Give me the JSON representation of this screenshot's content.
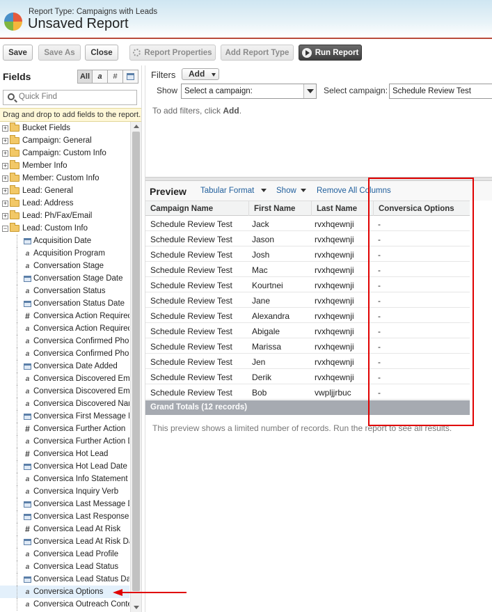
{
  "header": {
    "report_type": "Report Type: Campaigns with Leads",
    "title": "Unsaved Report"
  },
  "toolbar": {
    "save": "Save",
    "save_as": "Save As",
    "close": "Close",
    "report_properties": "Report Properties",
    "add_report_type": "Add Report Type",
    "run_report": "Run Report"
  },
  "fields_panel": {
    "title": "Fields",
    "filter_all": "All",
    "filter_text": "a",
    "filter_number": "#",
    "quick_find_placeholder": "Quick Find",
    "hint": "Drag and drop to add fields to the report.",
    "folders": [
      "Bucket Fields",
      "Campaign: General",
      "Campaign: Custom Info",
      "Member Info",
      "Member: Custom Info",
      "Lead: General",
      "Lead: Address",
      "Lead: Ph/Fax/Email",
      "Lead: Custom Info"
    ],
    "fields": [
      {
        "label": "Acquisition Date",
        "type": "date"
      },
      {
        "label": "Acquisition Program",
        "type": "text"
      },
      {
        "label": "Conversation Stage",
        "type": "text"
      },
      {
        "label": "Conversation Stage Date",
        "type": "date"
      },
      {
        "label": "Conversation Status",
        "type": "text"
      },
      {
        "label": "Conversation Status Date",
        "type": "date"
      },
      {
        "label": "Conversica Action Required",
        "type": "number"
      },
      {
        "label": "Conversica Action Required",
        "type": "text"
      },
      {
        "label": "Conversica Confirmed Phon",
        "type": "text"
      },
      {
        "label": "Conversica Confirmed Phon",
        "type": "text"
      },
      {
        "label": "Conversica Date Added",
        "type": "date"
      },
      {
        "label": "Conversica Discovered Ema",
        "type": "text"
      },
      {
        "label": "Conversica Discovered Ema",
        "type": "text"
      },
      {
        "label": "Conversica Discovered Nam",
        "type": "text"
      },
      {
        "label": "Conversica First Message D",
        "type": "date"
      },
      {
        "label": "Conversica Further Action",
        "type": "number"
      },
      {
        "label": "Conversica Further Action D",
        "type": "text"
      },
      {
        "label": "Conversica Hot Lead",
        "type": "number"
      },
      {
        "label": "Conversica Hot Lead Date",
        "type": "date"
      },
      {
        "label": "Conversica Info Statement",
        "type": "text"
      },
      {
        "label": "Conversica Inquiry Verb",
        "type": "text"
      },
      {
        "label": "Conversica Last Message D",
        "type": "date"
      },
      {
        "label": "Conversica Last Response D",
        "type": "date"
      },
      {
        "label": "Conversica Lead At Risk",
        "type": "number"
      },
      {
        "label": "Conversica Lead At Risk Da",
        "type": "date"
      },
      {
        "label": "Conversica Lead Profile",
        "type": "text"
      },
      {
        "label": "Conversica Lead Status",
        "type": "text"
      },
      {
        "label": "Conversica Lead Status Dat",
        "type": "date"
      },
      {
        "label": "Conversica Options",
        "type": "text"
      },
      {
        "label": "Conversica Outreach Contex",
        "type": "text"
      }
    ]
  },
  "filters": {
    "label": "Filters",
    "add": "Add",
    "show_label": "Show",
    "show_value": "Select a campaign:",
    "select_campaign_label": "Select campaign:",
    "campaign_value": "Schedule Review Test",
    "hint_prefix": "To add filters, click ",
    "hint_bold": "Add",
    "hint_suffix": "."
  },
  "preview": {
    "title": "Preview",
    "tabular_format": "Tabular Format",
    "show": "Show",
    "remove_all_columns": "Remove All Columns",
    "columns": [
      "Campaign Name",
      "First Name",
      "Last Name",
      "Conversica Options"
    ],
    "rows": [
      [
        "Schedule Review Test",
        "Jack",
        "rvxhqewnji",
        "-"
      ],
      [
        "Schedule Review Test",
        "Jason",
        "rvxhqewnji",
        "-"
      ],
      [
        "Schedule Review Test",
        "Josh",
        "rvxhqewnji",
        "-"
      ],
      [
        "Schedule Review Test",
        "Mac",
        "rvxhqewnji",
        "-"
      ],
      [
        "Schedule Review Test",
        "Kourtnei",
        "rvxhqewnji",
        "-"
      ],
      [
        "Schedule Review Test",
        "Jane",
        "rvxhqewnji",
        "-"
      ],
      [
        "Schedule Review Test",
        "Alexandra",
        "rvxhqewnji",
        "-"
      ],
      [
        "Schedule Review Test",
        "Abigale",
        "rvxhqewnji",
        "-"
      ],
      [
        "Schedule Review Test",
        "Marissa",
        "rvxhqewnji",
        "-"
      ],
      [
        "Schedule Review Test",
        "Jen",
        "rvxhqewnji",
        "-"
      ],
      [
        "Schedule Review Test",
        "Derik",
        "rvxhqewnji",
        "-"
      ],
      [
        "Schedule Review Test",
        "Bob",
        "vwpljjrbuc",
        "-"
      ]
    ],
    "grand_totals": "Grand Totals (12 records)",
    "limit_note": "This preview shows a limited number of records. Run the report to see all results."
  },
  "colors": {
    "annotation": "#e00000",
    "link": "#1f5e9c",
    "header_rule": "#b84a3a"
  }
}
